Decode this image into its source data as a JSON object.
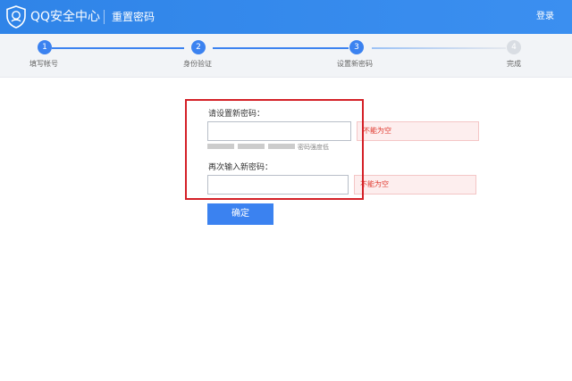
{
  "header": {
    "brand": "QQ安全中心",
    "page_title": "重置密码",
    "login": "登录"
  },
  "steps": [
    {
      "number": "1",
      "label": "填写帐号",
      "state": "done"
    },
    {
      "number": "2",
      "label": "身份验证",
      "state": "done"
    },
    {
      "number": "3",
      "label": "设置新密码",
      "state": "current"
    },
    {
      "number": "4",
      "label": "完成",
      "state": "todo"
    }
  ],
  "form": {
    "new_password_label": "请设置新密码：",
    "new_password_value": "",
    "new_password_error": "不能为空",
    "strength_text": "密码强度低",
    "confirm_password_label": "再次输入新密码：",
    "confirm_password_value": "",
    "confirm_password_error": "不能为空",
    "submit_label": "确定"
  },
  "colors": {
    "brand_blue": "#3b82f0",
    "error_red": "#e0392f",
    "highlight_red": "#d42027"
  },
  "icons": {
    "logo": "shield-icon"
  }
}
